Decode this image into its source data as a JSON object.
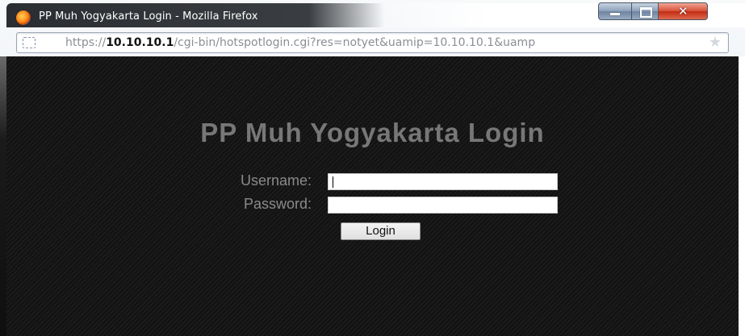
{
  "window": {
    "title": "PP Muh Yogyakarta Login - Mozilla Firefox"
  },
  "urlbar": {
    "prefix": "https://",
    "host": "10.10.10.1",
    "path": "/cgi-bin/hotspotlogin.cgi?res=notyet&uamip=10.10.10.1&uamp"
  },
  "icons": {
    "app": "firefox-icon",
    "site": "site-identity-icon",
    "bookmark": "star-icon"
  },
  "page": {
    "heading": "PP Muh Yogyakarta Login",
    "username_label": "Username:",
    "password_label": "Password:",
    "username_value": "",
    "password_value": "",
    "login_button": "Login"
  },
  "colors": {
    "page_background": "#161616",
    "heading_text": "#777777",
    "label_text": "#8a8a8a",
    "close_button": "#c22d12"
  }
}
